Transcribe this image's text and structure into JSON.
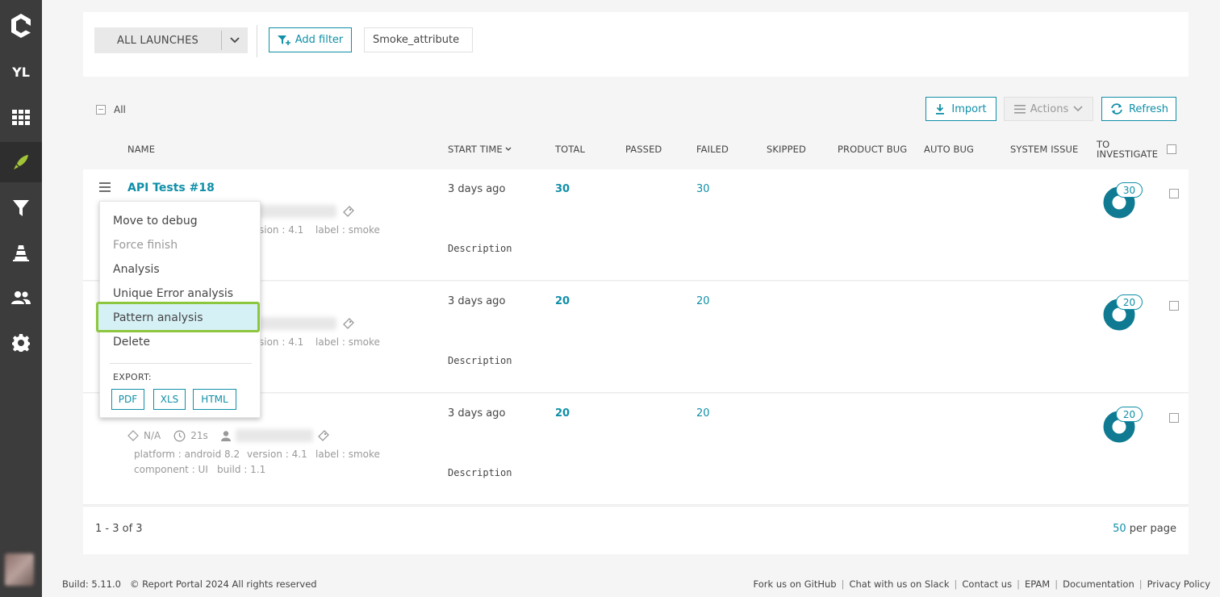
{
  "sidebar": {
    "project_initials": "YL",
    "items": [
      "logo-icon",
      "project-selector",
      "dashboard-icon",
      "launches-icon",
      "filters-icon",
      "debug-icon",
      "members-icon",
      "settings-icon"
    ]
  },
  "filter_bar": {
    "launch_selector": "ALL LAUNCHES",
    "add_filter": "Add filter",
    "active_filter": "Smoke_attribute"
  },
  "toolbar": {
    "all_label": "All",
    "import": "Import",
    "actions": "Actions",
    "refresh": "Refresh"
  },
  "columns": {
    "name": "NAME",
    "start_time": "START TIME",
    "total": "TOTAL",
    "passed": "PASSED",
    "failed": "FAILED",
    "skipped": "SKIPPED",
    "product_bug": "PRODUCT BUG",
    "auto_bug": "AUTO BUG",
    "system_issue": "SYSTEM ISSUE",
    "to_investigate_1": "TO",
    "to_investigate_2": "INVESTIGATE"
  },
  "rows": [
    {
      "name": "API Tests #18",
      "meta_partial": "sion : 4.1",
      "label": "label : smoke",
      "start": "3 days ago",
      "total": "30",
      "failed": "30",
      "to_investigate": "30",
      "description": "Description"
    },
    {
      "name": "",
      "meta_partial": "sion : 4.1",
      "label": "label : smoke",
      "start": "3 days ago",
      "total": "20",
      "failed": "20",
      "to_investigate": "20",
      "description": "Description"
    },
    {
      "name": "",
      "status": "N/A",
      "duration": "21s",
      "platform": "platform : android 8.2",
      "version": "version : 4.1",
      "label": "label : smoke",
      "component": "component : UI",
      "build": "build : 1.1",
      "start": "3 days ago",
      "total": "20",
      "failed": "20",
      "to_investigate": "20",
      "description": "Description"
    }
  ],
  "context_menu": {
    "items": [
      "Move to debug",
      "Force finish",
      "Analysis",
      "Unique Error analysis",
      "Pattern analysis",
      "Delete"
    ],
    "export_label": "EXPORT:",
    "export_buttons": [
      "PDF",
      "XLS",
      "HTML"
    ]
  },
  "pagination": {
    "range": "1 - 3 of 3",
    "per_page_num": "50",
    "per_page_label": "per page"
  },
  "footer": {
    "build": "Build: 5.11.0",
    "copyright": "© Report Portal 2024 All rights reserved",
    "links": [
      "Fork us on GitHub",
      "Chat with us on Slack",
      "Contact us",
      "EPAM",
      "Documentation",
      "Privacy Policy"
    ]
  },
  "colors": {
    "accent": "#0f8fa8",
    "sidebar_bg": "#3c3c3c",
    "active_launch_icon": "#a2c437",
    "highlight_border": "#8dc63f"
  }
}
